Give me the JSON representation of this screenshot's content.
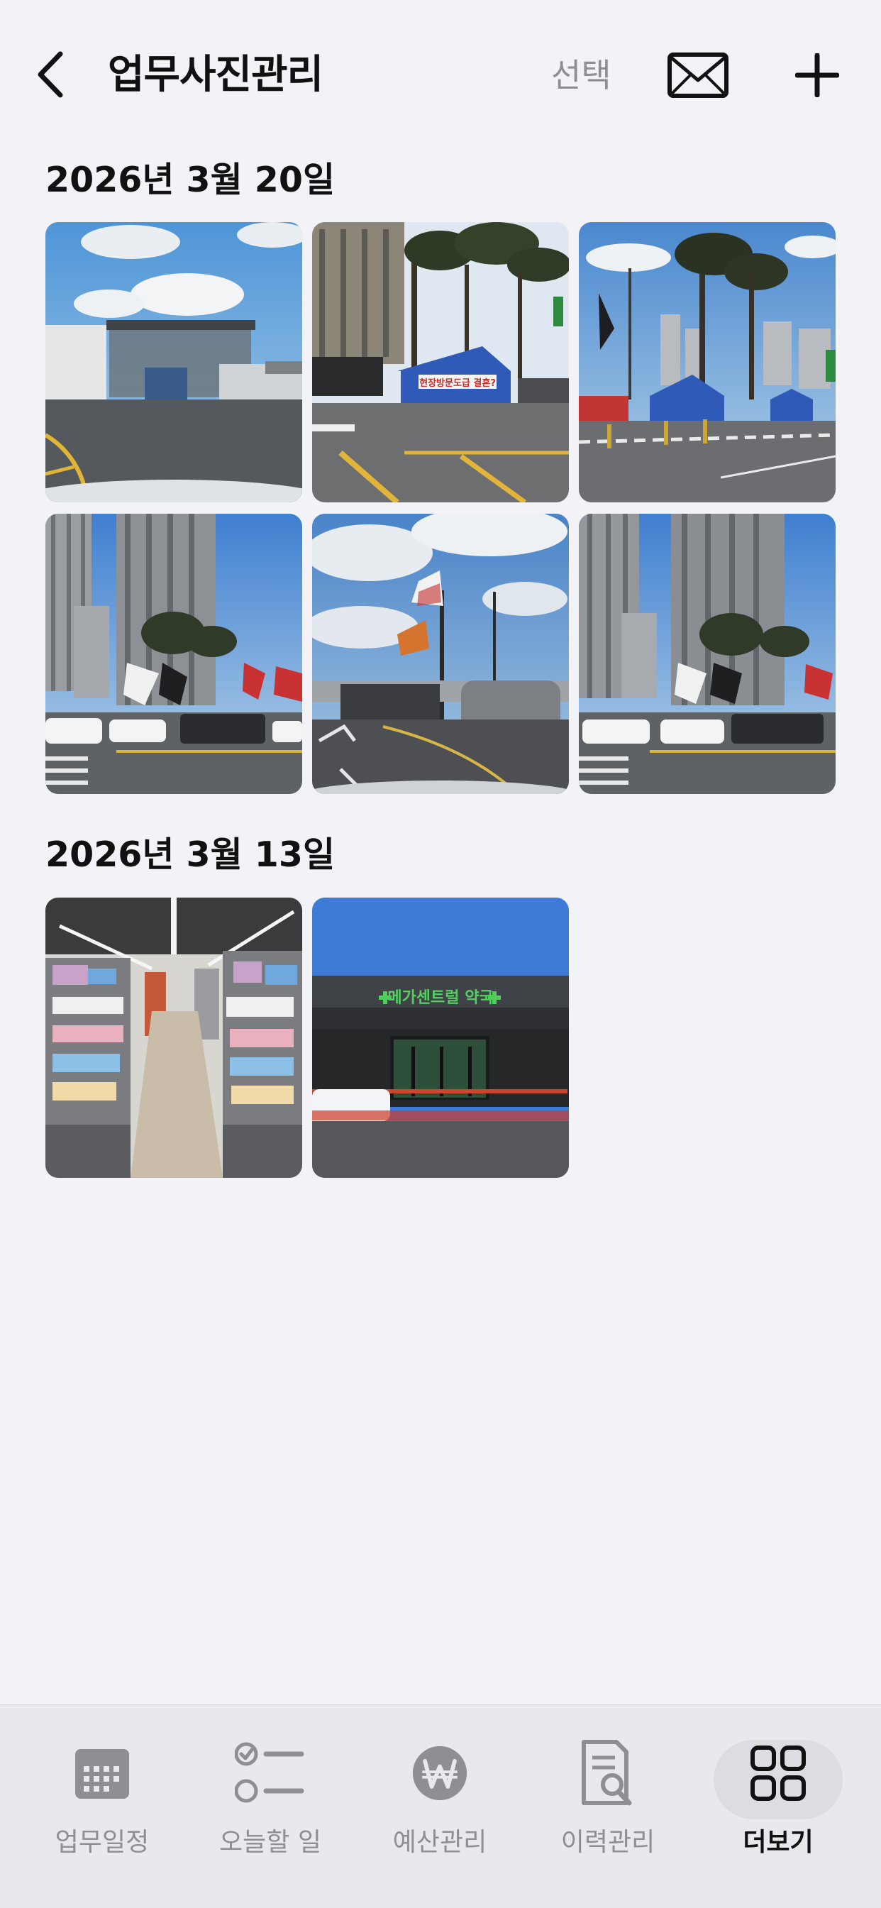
{
  "header": {
    "title": "업무사진관리",
    "select_label": "선택"
  },
  "sections": [
    {
      "date": "2026년 3월 20일"
    },
    {
      "date": "2026년 3월 13일"
    }
  ],
  "photos": {
    "construction_gate_banner": "현장방문도급 결혼?",
    "store_sign": "메가센트럴 약국"
  },
  "tabbar": {
    "items": [
      {
        "label": "업무일정",
        "icon": "calendar-icon"
      },
      {
        "label": "오늘할 일",
        "icon": "checklist-icon"
      },
      {
        "label": "예산관리",
        "icon": "won-coin-icon"
      },
      {
        "label": "이력관리",
        "icon": "document-search-icon"
      },
      {
        "label": "더보기",
        "icon": "grid-icon",
        "active": true
      }
    ]
  }
}
